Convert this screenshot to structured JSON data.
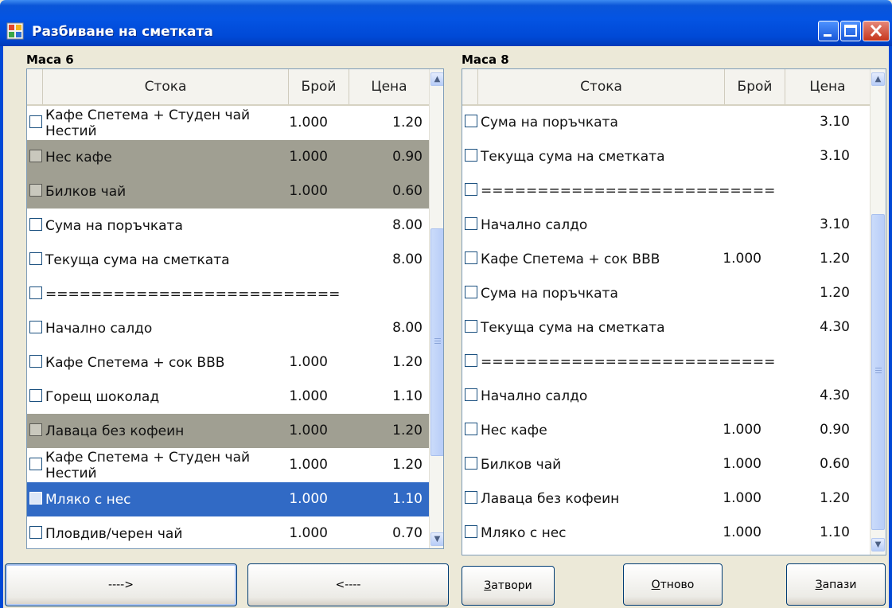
{
  "window": {
    "title": "Разбиване на сметката"
  },
  "left": {
    "caption": "Маса 6",
    "columns": {
      "item": "Стока",
      "qty": "Брой",
      "price": "Цена"
    },
    "rows": [
      {
        "name": "Кафе Спетема + Студен чай\nНестий",
        "qty": "1.000",
        "price": "1.20",
        "state": "normal"
      },
      {
        "name": "Нес кафе",
        "qty": "1.000",
        "price": "0.90",
        "state": "gray"
      },
      {
        "name": "Билков чай",
        "qty": "1.000",
        "price": "0.60",
        "state": "gray"
      },
      {
        "name": "Сума на поръчката",
        "qty": "",
        "price": "8.00",
        "state": "normal"
      },
      {
        "name": "Текуща сума на сметката",
        "qty": "",
        "price": "8.00",
        "state": "normal"
      },
      {
        "name": "==========================",
        "qty": "",
        "price": "",
        "state": "normal"
      },
      {
        "name": "Начално салдо",
        "qty": "",
        "price": "8.00",
        "state": "normal"
      },
      {
        "name": "Кафе Спетема + сок ВВВ",
        "qty": "1.000",
        "price": "1.20",
        "state": "normal"
      },
      {
        "name": "Горещ шоколад",
        "qty": "1.000",
        "price": "1.10",
        "state": "normal"
      },
      {
        "name": "Лаваца без кофеин",
        "qty": "1.000",
        "price": "1.20",
        "state": "gray"
      },
      {
        "name": "Кафе Спетема + Студен чай\nНестий",
        "qty": "1.000",
        "price": "1.20",
        "state": "normal"
      },
      {
        "name": "Мляко с нес",
        "qty": "1.000",
        "price": "1.10",
        "state": "blue"
      },
      {
        "name": "Пловдив/черен чай",
        "qty": "1.000",
        "price": "0.70",
        "state": "normal"
      }
    ]
  },
  "right": {
    "caption": "Маса 8",
    "columns": {
      "item": "Стока",
      "qty": "Брой",
      "price": "Цена"
    },
    "rows": [
      {
        "name": "Сума на поръчката",
        "qty": "",
        "price": "3.10"
      },
      {
        "name": "Текуща сума на сметката",
        "qty": "",
        "price": "3.10"
      },
      {
        "name": "==========================",
        "qty": "",
        "price": ""
      },
      {
        "name": "Начално салдо",
        "qty": "",
        "price": "3.10"
      },
      {
        "name": "Кафе Спетема + сок ВВВ",
        "qty": "1.000",
        "price": "1.20"
      },
      {
        "name": "Сума на поръчката",
        "qty": "",
        "price": "1.20"
      },
      {
        "name": "Текуща сума на сметката",
        "qty": "",
        "price": "4.30"
      },
      {
        "name": "==========================",
        "qty": "",
        "price": ""
      },
      {
        "name": "Начално салдо",
        "qty": "",
        "price": "4.30"
      },
      {
        "name": "Нес кафе",
        "qty": "1.000",
        "price": "0.90"
      },
      {
        "name": "Билков чай",
        "qty": "1.000",
        "price": "0.60"
      },
      {
        "name": "Лаваца без кофеин",
        "qty": "1.000",
        "price": "1.20"
      },
      {
        "name": "Мляко с нес",
        "qty": "1.000",
        "price": "1.10"
      }
    ]
  },
  "buttons": {
    "move_right": "---->",
    "move_left": "<----",
    "close_prefix": "З",
    "close_rest": "атвори",
    "reset_prefix": "О",
    "reset_rest": "тново",
    "save_prefix": "З",
    "save_rest": "апази"
  },
  "icons": {
    "app": "app-window-icon",
    "minimize": "minimize-icon",
    "maximize": "maximize-icon",
    "close": "close-x-icon"
  },
  "colors": {
    "titlebar": "#0454e3",
    "selection": "#316ac5",
    "highlight_gray": "#a09f92"
  }
}
